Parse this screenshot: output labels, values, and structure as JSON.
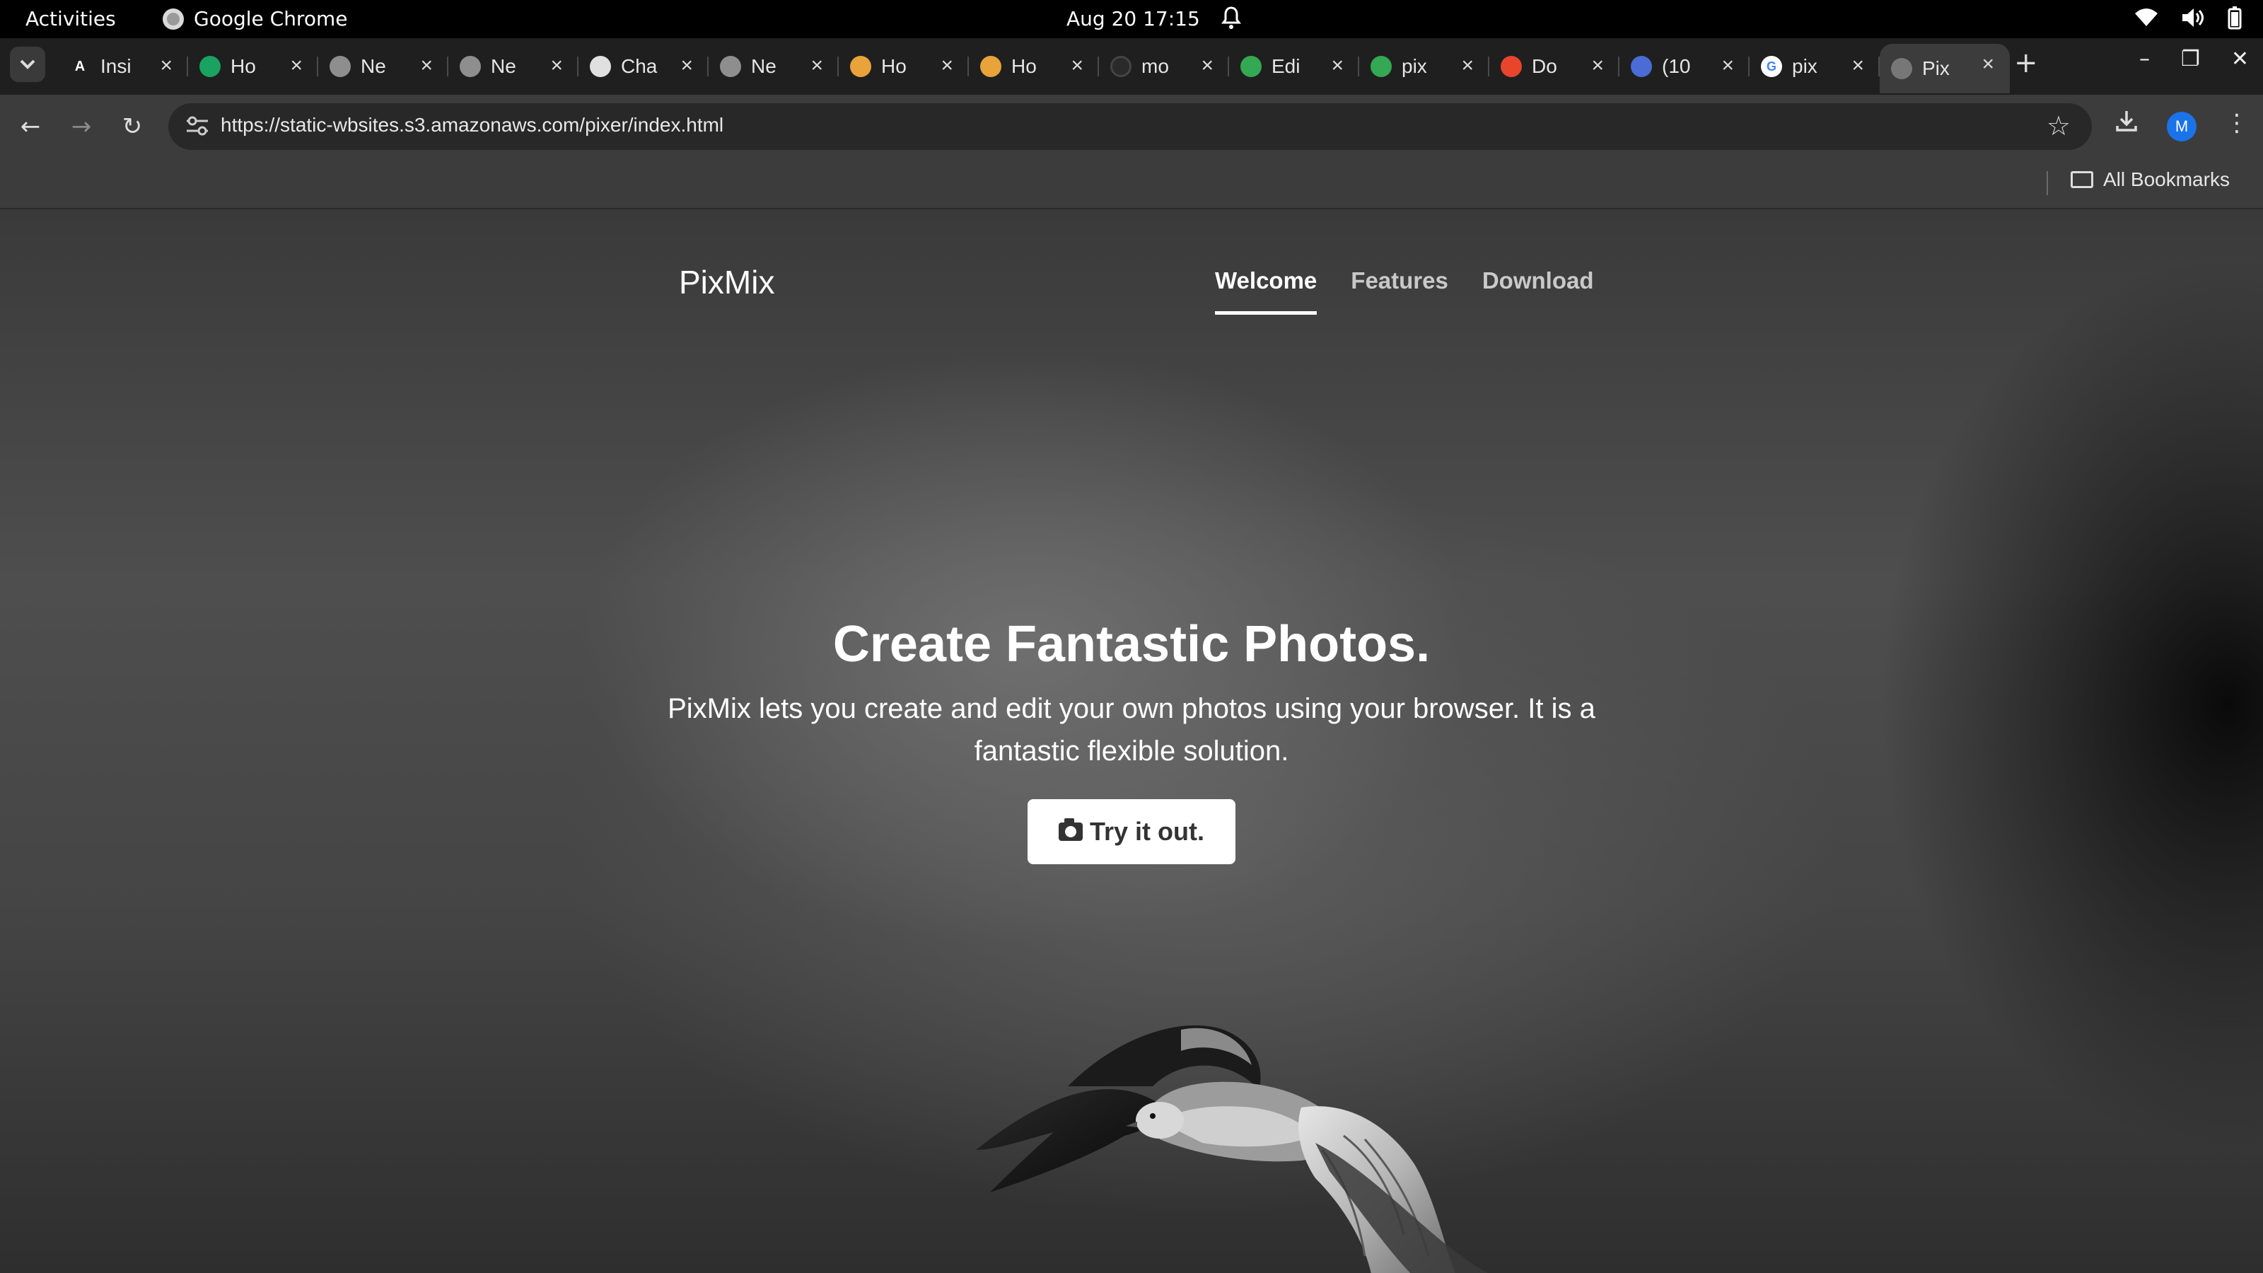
{
  "system_bar": {
    "activities": "Activities",
    "app_name": "Google Chrome",
    "clock": "Aug 20  17:15"
  },
  "tabs": [
    {
      "title": "Insi",
      "icon": "letter-a-icon",
      "color": "#1f1f1f"
    },
    {
      "title": "Ho",
      "icon": "green-spiral-icon",
      "color": "#1aa260"
    },
    {
      "title": "Ne",
      "icon": "chrome-icon",
      "color": "#8e8e8e"
    },
    {
      "title": "Ne",
      "icon": "chrome-icon",
      "color": "#8e8e8e"
    },
    {
      "title": "Cha",
      "icon": "openai-icon",
      "color": "#e0e0e0"
    },
    {
      "title": "Ne",
      "icon": "chrome-icon",
      "color": "#8e8e8e"
    },
    {
      "title": "Ho",
      "icon": "box-icon",
      "color": "#e8a33a"
    },
    {
      "title": "Ho",
      "icon": "box-icon",
      "color": "#e8a33a"
    },
    {
      "title": "mo",
      "icon": "circle-icon",
      "color": "#2a2a2a"
    },
    {
      "title": "Edi",
      "icon": "green-square-icon",
      "color": "#34a853"
    },
    {
      "title": "pix",
      "icon": "green-square-icon",
      "color": "#34a853"
    },
    {
      "title": "Do",
      "icon": "red-chart-icon",
      "color": "#e8452c"
    },
    {
      "title": "(10",
      "icon": "flask-icon",
      "color": "#4a6cd4"
    },
    {
      "title": "pix",
      "icon": "google-icon",
      "color": "#ffffff"
    },
    {
      "title": "Pix",
      "icon": "globe-icon",
      "color": "#777777",
      "active": true
    }
  ],
  "omnibox": {
    "url": "https://static-wbsites.s3.amazonaws.com/pixer/index.html"
  },
  "profile_initial": "M",
  "bookmarks": {
    "all_label": "All Bookmarks"
  },
  "site": {
    "brand": "PixMix",
    "nav": [
      "Welcome",
      "Features",
      "Download"
    ],
    "hero_title": "Create Fantastic Photos.",
    "hero_text": "PixMix lets you create and edit your own photos using your browser. It is a fantastic flexible solution.",
    "cta_label": "Try it out."
  }
}
